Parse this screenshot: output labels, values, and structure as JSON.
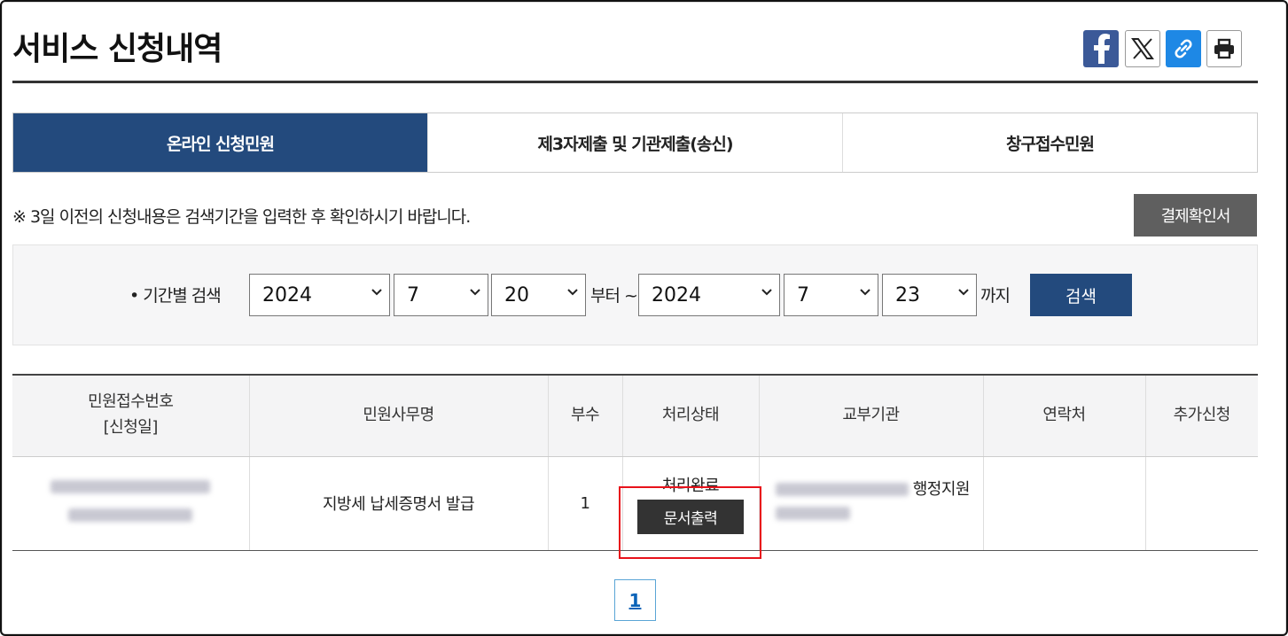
{
  "page": {
    "title": "서비스 신청내역"
  },
  "share": {
    "facebook_icon": "facebook-icon",
    "x_icon": "x-twitter-icon",
    "link_icon": "link-icon",
    "print_icon": "printer-icon"
  },
  "tabs": [
    {
      "label": "온라인 신청민원",
      "active": true
    },
    {
      "label": "제3자제출 및 기관제출(송신)",
      "active": false
    },
    {
      "label": "창구접수민원",
      "active": false
    }
  ],
  "notice": "※ 3일 이전의 신청내용은 검색기간을 입력한 후 확인하시기 바랍니다.",
  "receipt_button": "결제확인서",
  "search": {
    "label": "• 기간별 검색",
    "from_year": "2024",
    "from_month": "7",
    "from_day": "20",
    "from_suffix": "부터 ~",
    "to_year": "2024",
    "to_month": "7",
    "to_day": "23",
    "to_suffix": "까지",
    "button": "검색"
  },
  "table": {
    "headers": {
      "receipt_no": "민원접수번호",
      "receipt_date": "[신청일]",
      "name": "민원사무명",
      "copies": "부수",
      "status": "처리상태",
      "agency": "교부기관",
      "contact": "연락처",
      "additional": "추가신청"
    },
    "rows": [
      {
        "name": "지방세 납세증명서 발급",
        "copies": "1",
        "status": "처리완료",
        "print_button": "문서출력",
        "agency_suffix": "행정지원"
      }
    ]
  },
  "pagination": {
    "current": "1"
  },
  "colors": {
    "primary": "#234a7d",
    "highlight": "#e8121b",
    "receipt_button": "#5f5f5f"
  }
}
